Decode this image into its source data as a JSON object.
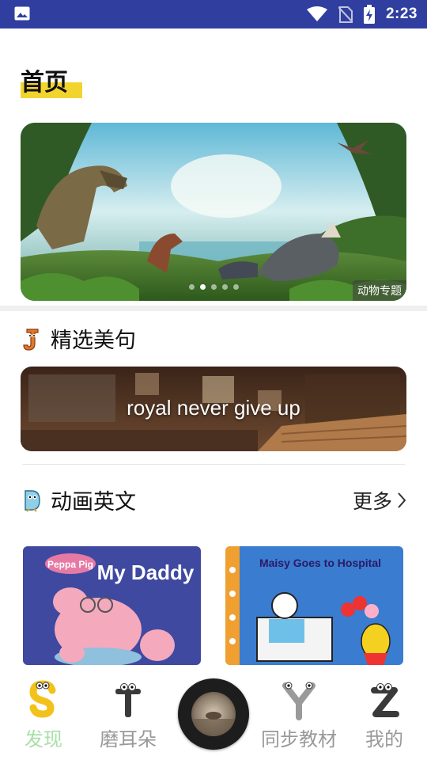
{
  "status_bar": {
    "time": "2:23"
  },
  "page": {
    "title": "首页"
  },
  "banner": {
    "tag": "动物专题",
    "dots": 5,
    "active_dot": 1
  },
  "featured_quotes": {
    "title": "精选美句",
    "quote": "royal never give up"
  },
  "animation_english": {
    "title": "动画英文",
    "more_label": "更多"
  },
  "books": [
    {
      "cover_title": "My Daddy",
      "brand": "Peppa Pig"
    },
    {
      "cover_title": "Maisy Goes to Hospital"
    }
  ],
  "tabs": [
    {
      "label": "发现",
      "active": true,
      "icon": "letter-s-icon"
    },
    {
      "label": "磨耳朵",
      "active": false,
      "icon": "letter-t-icon"
    },
    {
      "label": "同步教材",
      "active": false,
      "icon": "letter-y-icon"
    },
    {
      "label": "我的",
      "active": false,
      "icon": "letter-z-icon"
    }
  ],
  "colors": {
    "status_bar": "#303f9f",
    "tab_active": "#a9dfa7",
    "tab_inactive": "#999999",
    "title_highlight": "#f2d42e"
  }
}
